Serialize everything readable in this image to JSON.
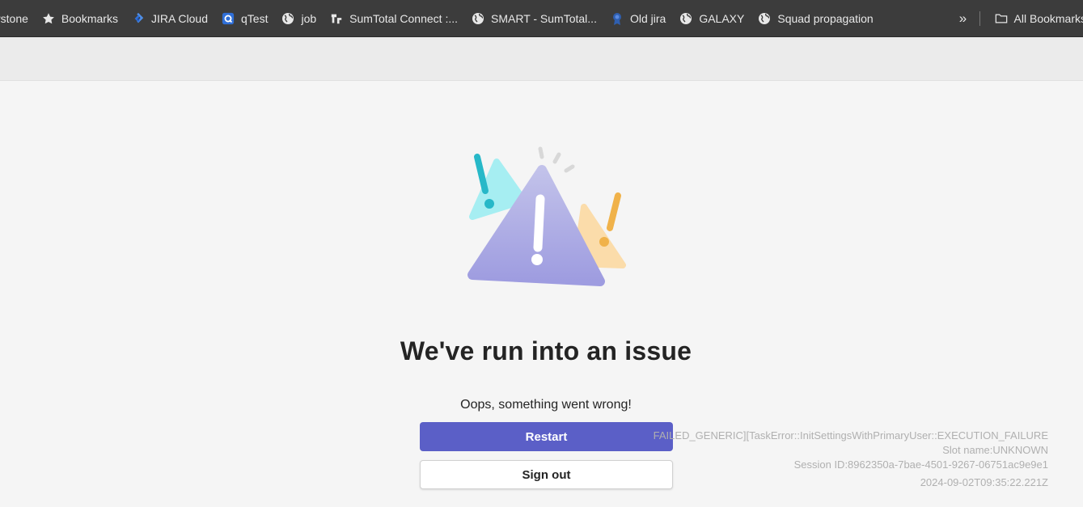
{
  "bookmarks": {
    "items": [
      {
        "label": "rstone",
        "icon": "none"
      },
      {
        "label": "Bookmarks",
        "icon": "star-icon"
      },
      {
        "label": "JIRA Cloud",
        "icon": "jira-icon"
      },
      {
        "label": "qTest",
        "icon": "qtest-icon"
      },
      {
        "label": "job",
        "icon": "globe-icon"
      },
      {
        "label": "SumTotal Connect :...",
        "icon": "sumtotal-icon"
      },
      {
        "label": "SMART - SumTotal...",
        "icon": "globe-icon"
      },
      {
        "label": "Old jira",
        "icon": "badge-icon"
      },
      {
        "label": "GALAXY",
        "icon": "globe-icon"
      },
      {
        "label": "Squad propagation",
        "icon": "globe-icon"
      }
    ],
    "overflow_glyph": "»",
    "all_bookmarks_label": "All Bookmarks"
  },
  "error": {
    "title": "We've run into an issue",
    "subtitle": "Oops, something went wrong!",
    "restart_label": "Restart",
    "signout_label": "Sign out"
  },
  "diagnostics": {
    "error_code": "FAILED_GENERIC][TaskError::InitSettingsWithPrimaryUser::EXECUTION_FAILURE",
    "slot_name": "Slot name:UNKNOWN",
    "session_id": "Session ID:8962350a-7bae-4501-9267-06751ac9e9e1",
    "timestamp": "2024-09-02T09:35:22.221Z"
  },
  "colors": {
    "accent": "#5b5fc7",
    "bookmarks_bar_bg": "#3c3c3c",
    "page_bg": "#f5f5f5",
    "warning_main": "#a9a8e3",
    "warning_teal": "#7fe0e6",
    "warning_orange": "#f8d39a"
  }
}
